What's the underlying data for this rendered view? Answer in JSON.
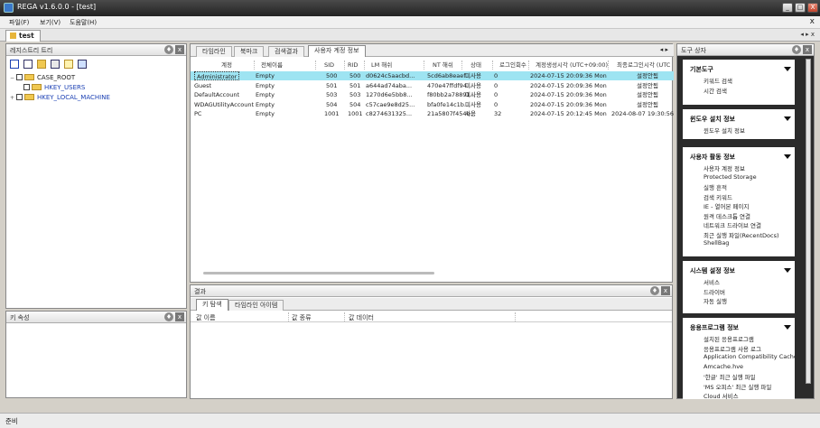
{
  "window": {
    "title": "REGA v1.6.0.0 - [test]",
    "buttons": [
      "_",
      "□",
      "X"
    ]
  },
  "menu": {
    "items": [
      "파일(F)",
      "보기(V)",
      "도움말(H)"
    ],
    "close": "x"
  },
  "doc_tab": {
    "label": "test",
    "nav": "◂ ▸ x"
  },
  "registry_tree": {
    "title": "레지스트리 트리",
    "pin": "♦",
    "close": "x",
    "nodes": [
      {
        "label": "CASE_ROOT",
        "expand": "−"
      },
      {
        "label": "HKEY_USERS",
        "expand": ""
      },
      {
        "label": "HKEY_LOCAL_MACHINE",
        "expand": "+"
      }
    ]
  },
  "key_props": {
    "title": "키 속성",
    "pin": "♦",
    "close": "x"
  },
  "center": {
    "tabs": [
      "타임라인",
      "북마크",
      "검색결과",
      "사용자 계정 정보"
    ],
    "tab_nav": "◂ ▸",
    "columns": [
      "계정",
      "전체이름",
      "SID",
      "RID",
      "LM 해쉬",
      "NT 해쉬",
      "상태",
      "로그인회수",
      "계정생성시각 (UTC+09:00)",
      "최종로그인시각 (UTC"
    ],
    "rows": [
      [
        "Administrator",
        "Empty",
        "500",
        "500",
        "d0624c5aacbd...",
        "5cd6ab8eaef...",
        "미사용",
        "0",
        "2024-07-15 20:09:36 Mon",
        "설정안됨"
      ],
      [
        "Guest",
        "Empty",
        "501",
        "501",
        "a644ad74aba...",
        "470e47ffdf94...",
        "미사용",
        "0",
        "2024-07-15 20:09:36 Mon",
        "설정안됨"
      ],
      [
        "DefaultAccount",
        "Empty",
        "503",
        "503",
        "1270d6e5bb8...",
        "f80bb2a78891...",
        "미사용",
        "0",
        "2024-07-15 20:09:36 Mon",
        "설정안됨"
      ],
      [
        "WDAGUtilityAccount",
        "Empty",
        "504",
        "504",
        "c57cae9e8d25...",
        "bfa0fe14c1b...",
        "미사용",
        "0",
        "2024-07-15 20:09:36 Mon",
        "설정안됨"
      ],
      [
        "PC",
        "Empty",
        "1001",
        "1001",
        "c8274631325...",
        "21a5807f454b...",
        "사용",
        "32",
        "2024-07-15 20:12:45 Mon",
        "2024-08-07 19:30:56"
      ]
    ]
  },
  "output": {
    "title": "결과",
    "pin": "♦",
    "close": "x",
    "tabs": [
      "키 탐색",
      "타임라인 아이템"
    ],
    "columns": [
      "값 이름",
      "값 종류",
      "값 데이터"
    ]
  },
  "toolbox": {
    "title": "도구 상자",
    "pin": "♦",
    "close": "x",
    "groups": [
      {
        "title": "기본도구",
        "items": [
          "키워드 검색",
          "시간 검색"
        ]
      },
      {
        "title": "윈도우 설치 정보",
        "items": [
          "윈도우 설치 정보"
        ]
      },
      {
        "title": "사용자 활동 정보",
        "items": [
          "사용자 계정 정보",
          "Protected Storage",
          "실행 흔적",
          "검색 키워드",
          "IE - 열어본 페이지",
          "원격 데스크톱 연결",
          "네트워크 드라이브 연결",
          "최근 실행 파일(RecentDocs)",
          "ShellBag"
        ]
      },
      {
        "title": "시스템 설정 정보",
        "items": [
          "서비스",
          "드라이버",
          "자동 실행"
        ]
      },
      {
        "title": "응용프로그램 정보",
        "items": [
          "설치된 응용프로그램",
          "응용프로그램 사용 로그",
          "Application Compatibility Cache",
          "Amcache.hve",
          "'한글' 최근 실행 파일",
          "'MS 오피스' 최근 실행 파일",
          "Cloud 서비스"
        ]
      }
    ]
  },
  "status": {
    "text": "준비"
  },
  "colors": {
    "row_selected": "#9ee4f2",
    "tree_blue": "#1a3fb3",
    "titlebar": "#2d2d2d"
  }
}
